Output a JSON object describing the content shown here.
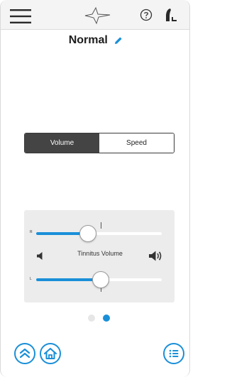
{
  "header": {
    "icons": [
      "menu-icon",
      "logo-icon",
      "help-icon",
      "hearing-aid-icon"
    ]
  },
  "program": {
    "title": "Normal",
    "edit_icon": "pencil-icon"
  },
  "mode_toggle": {
    "options": [
      "Volume",
      "Speed"
    ],
    "selected": "Volume"
  },
  "tinnitus": {
    "label": "Tinnitus Volume",
    "right_channel": {
      "label": "R",
      "level": 0.41
    },
    "left_channel": {
      "label": "L",
      "level": 0.51
    },
    "decrease_icon": "speaker-low-icon",
    "increase_icon": "speaker-high-icon"
  },
  "pager": {
    "count": 2,
    "active": 2
  },
  "footer": {
    "icons": [
      "collapse-up-icon",
      "home-icon",
      "list-icon"
    ]
  },
  "colors": {
    "accent": "#1a8fd8",
    "segment_active": "#444444",
    "panel_bg": "#ececec",
    "header_bg": "#f4f4f4"
  }
}
